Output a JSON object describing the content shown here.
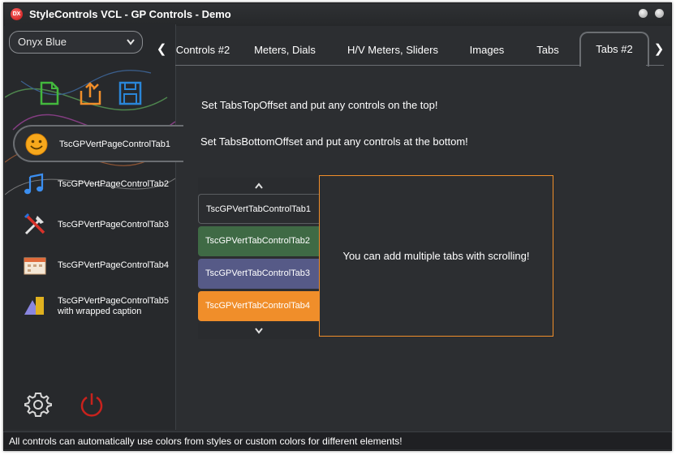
{
  "window": {
    "title": "StyleControls VCL - GP Controls - Demo",
    "app_icon_text": "DX"
  },
  "sidebar": {
    "style_combo": "Onyx Blue",
    "items": [
      {
        "label": "TscGPVertPageControlTab1",
        "icon": "smiley-icon"
      },
      {
        "label": "TscGPVertPageControlTab2",
        "icon": "music-note-icon"
      },
      {
        "label": "TscGPVertPageControlTab3",
        "icon": "tools-icon"
      },
      {
        "label": "TscGPVertPageControlTab4",
        "icon": "calendar-icon"
      },
      {
        "label_line1": "TscGPVertPageControlTab5",
        "label_line2": "with wrapped caption",
        "icon": "shapes-icon"
      }
    ]
  },
  "tabs": {
    "items": [
      "Controls #2",
      "Meters, Dials",
      "H/V Meters, Sliders",
      "Images",
      "Tabs",
      "Tabs #2"
    ],
    "active": "Tabs #2"
  },
  "content": {
    "line1": "Set TabsTopOffset and put any controls on the top!",
    "line2": "Set TabsBottomOffset and put any controls at the bottom!",
    "inner_tabs": [
      "TscGPVertTabControlTab1",
      "TscGPVertTabControlTab2",
      "TscGPVertTabControlTab3",
      "TscGPVertTabControlTab4"
    ],
    "inner_panel_text": "You can add multiple tabs with scrolling!"
  },
  "status": {
    "text": "All controls can automatically use colors from styles or custom colors for different elements!"
  },
  "colors": {
    "accent_orange": "#f08e2a",
    "tab_green": "#3f6a45",
    "tab_purple": "#565a87"
  }
}
